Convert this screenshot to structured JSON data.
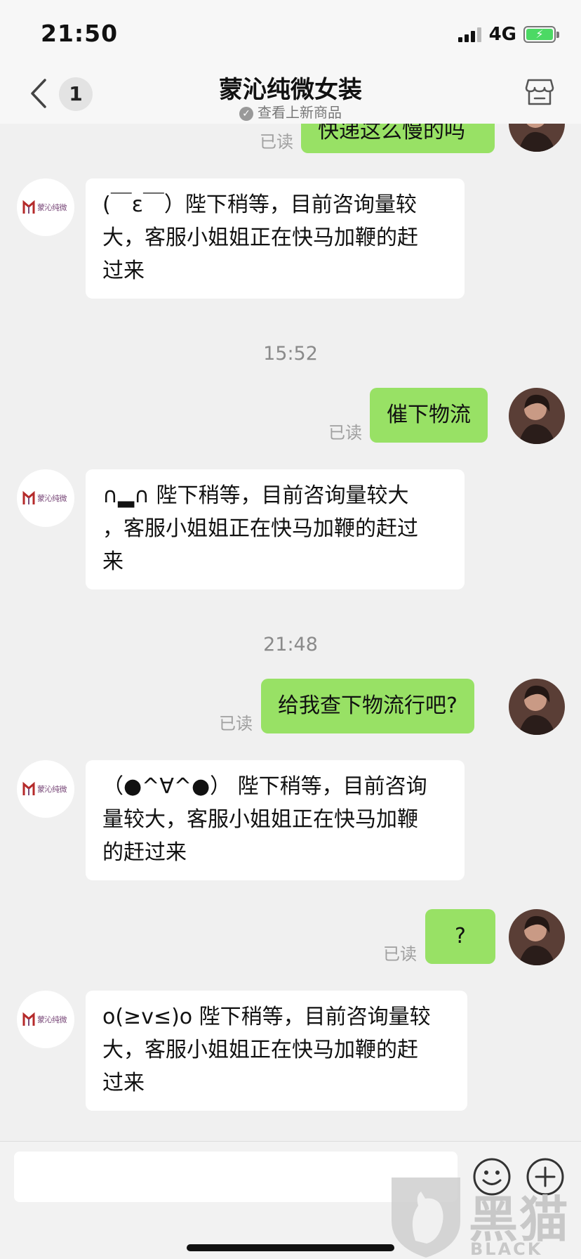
{
  "status_bar": {
    "time": "21:50",
    "network": "4G"
  },
  "header": {
    "unread_count": "1",
    "title": "蒙沁纯微女装",
    "subtitle": "查看上新商品"
  },
  "shop_logo_text": "蒙沁纯微",
  "messages": [
    {
      "from": "me",
      "text": "快递这么慢的吗",
      "read": "已读"
    },
    {
      "from": "shop",
      "lines": [
        "(￣ε￣）陛下稍等，目前咨询量较",
        "大，客服小姐姐正在快马加鞭的赶",
        "过来"
      ]
    },
    {
      "from": "time",
      "text": "15:52"
    },
    {
      "from": "me",
      "text": "催下物流",
      "read": "已读"
    },
    {
      "from": "shop",
      "lines": [
        "∩▂∩ 陛下稍等，目前咨询量较大",
        "，客服小姐姐正在快马加鞭的赶过",
        "来"
      ]
    },
    {
      "from": "time",
      "text": "21:48"
    },
    {
      "from": "me",
      "text": "给我查下物流行吧?",
      "read": "已读"
    },
    {
      "from": "shop",
      "lines": [
        "（●^∀^●） 陛下稍等，目前咨询",
        "量较大，客服小姐姐正在快马加鞭",
        "的赶过来"
      ]
    },
    {
      "from": "me",
      "text": "?",
      "read": "已读"
    },
    {
      "from": "shop",
      "lines": [
        "o(≥v≤)o 陛下稍等，目前咨询量较",
        "大，客服小姐姐正在快马加鞭的赶",
        "过来"
      ]
    }
  ],
  "input": {
    "placeholder": ""
  },
  "watermark": {
    "text": "黑猫",
    "sub": "BLACK CAT"
  },
  "colors": {
    "outgoing_bubble": "#98e165",
    "background": "#f0f0f0",
    "incoming_bubble": "#ffffff"
  }
}
